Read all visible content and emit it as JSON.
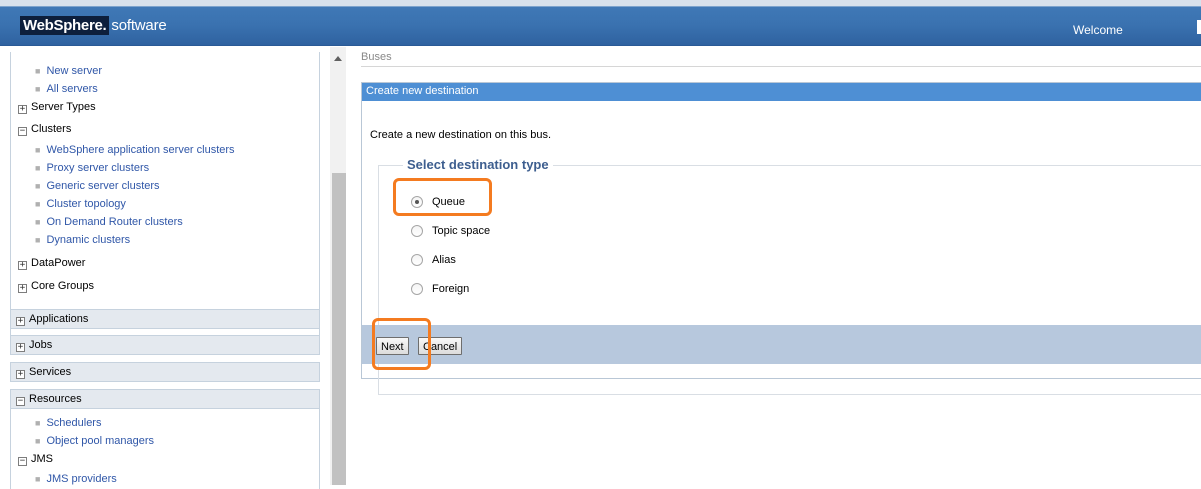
{
  "header": {
    "brand": "WebSphere.",
    "product": "software",
    "welcome": "Welcome"
  },
  "nav": {
    "servers_links": [
      "New server",
      "All servers"
    ],
    "server_types": "Server Types",
    "clusters": "Clusters",
    "cluster_links": [
      "WebSphere application server clusters",
      "Proxy server clusters",
      "Generic server clusters",
      "Cluster topology",
      "On Demand Router clusters",
      "Dynamic clusters"
    ],
    "datapower": "DataPower",
    "core_groups": "Core Groups",
    "applications": "Applications",
    "jobs": "Jobs",
    "services": "Services",
    "resources": "Resources",
    "resource_links": [
      "Schedulers",
      "Object pool managers"
    ],
    "jms": "JMS",
    "jms_links": [
      "JMS providers"
    ]
  },
  "main": {
    "breadcrumb": "Buses",
    "panel_title": "Create new destination",
    "description": "Create a new destination on this bus.",
    "legend": "Select destination type",
    "options": [
      {
        "label": "Queue",
        "checked": true
      },
      {
        "label": "Topic space",
        "checked": false
      },
      {
        "label": "Alias",
        "checked": false
      },
      {
        "label": "Foreign",
        "checked": false
      }
    ],
    "next_label": "Next",
    "cancel_label": "Cancel"
  },
  "colors": {
    "header_blue": "#3a72b0",
    "panel_title_blue": "#4e8fd4",
    "button_bar": "#b7c8dd",
    "link_blue": "#3057a8",
    "highlight_orange": "#f47b20"
  }
}
